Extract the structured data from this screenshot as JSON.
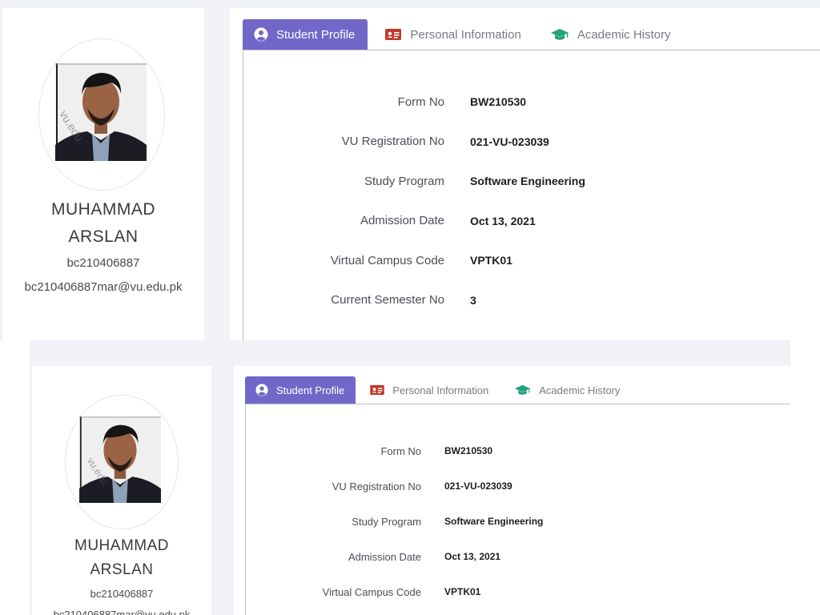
{
  "student": {
    "name_line1": "MUHAMMAD",
    "name_line2": "ARSLAN",
    "id": "bc210406887",
    "email": "bc210406887mar@vu.edu.pk",
    "watermark": "vu.edu."
  },
  "tabs": [
    {
      "label": "Student Profile",
      "icon": "user-circle-icon",
      "active": true
    },
    {
      "label": "Personal Information",
      "icon": "id-card-icon",
      "active": false
    },
    {
      "label": "Academic History",
      "icon": "graduation-cap-icon",
      "active": false
    }
  ],
  "profile_fields": [
    {
      "label": "Form No",
      "value": "BW210530"
    },
    {
      "label": "VU Registration No",
      "value": "021-VU-023039"
    },
    {
      "label": "Study Program",
      "value": "Software Engineering"
    },
    {
      "label": "Admission Date",
      "value": "Oct 13, 2021"
    },
    {
      "label": "Virtual Campus Code",
      "value": "VPTK01"
    },
    {
      "label": "Current Semester No",
      "value": "3"
    }
  ],
  "colors": {
    "active_tab": "#7267c8",
    "id_card_icon": "#c0392b",
    "graduation_cap_icon": "#1fa37a",
    "page_background": "#f1f2f7"
  }
}
